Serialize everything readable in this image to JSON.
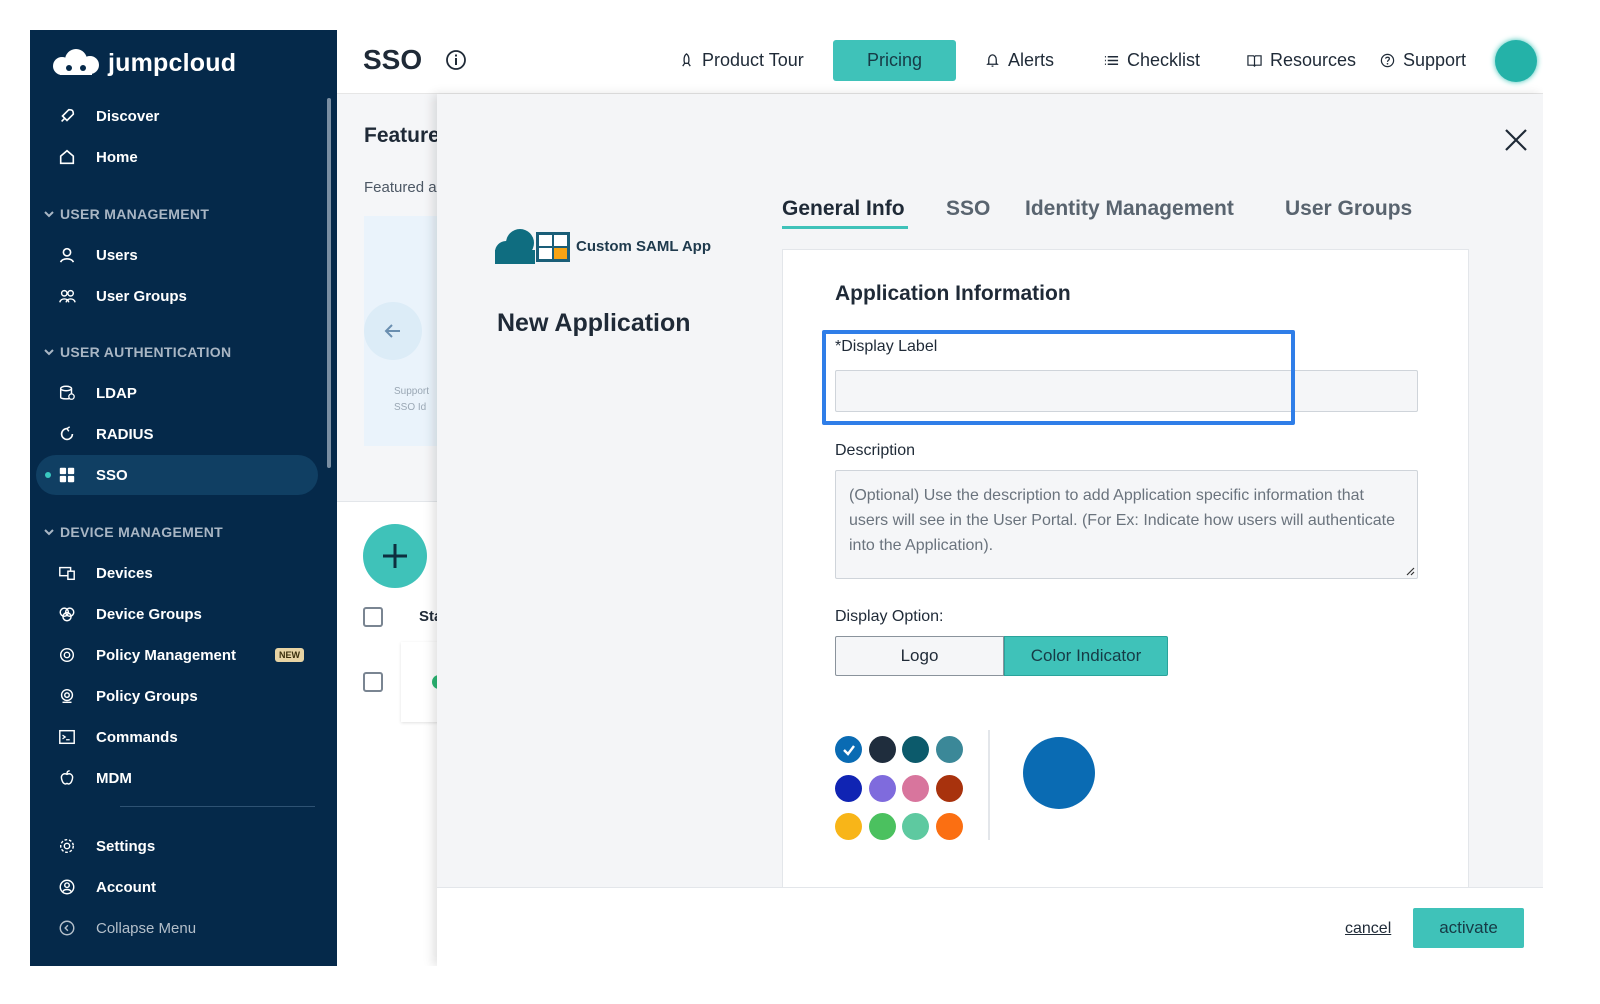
{
  "brand": {
    "name": "jumpcloud",
    "accent": "#3fc2b9",
    "sidebar_bg": "#05294a"
  },
  "sidebar": {
    "top_items": [
      {
        "label": "Discover",
        "icon": "rocket-icon"
      },
      {
        "label": "Home",
        "icon": "home-icon"
      }
    ],
    "sections": [
      {
        "title": "USER MANAGEMENT",
        "items": [
          {
            "label": "Users",
            "icon": "user-icon"
          },
          {
            "label": "User Groups",
            "icon": "user-group-icon"
          }
        ]
      },
      {
        "title": "USER AUTHENTICATION",
        "items": [
          {
            "label": "LDAP",
            "icon": "ldap-icon"
          },
          {
            "label": "RADIUS",
            "icon": "radius-icon"
          },
          {
            "label": "SSO",
            "icon": "sso-grid-icon",
            "active": true
          }
        ]
      },
      {
        "title": "DEVICE MANAGEMENT",
        "items": [
          {
            "label": "Devices",
            "icon": "devices-icon"
          },
          {
            "label": "Device Groups",
            "icon": "device-group-icon"
          },
          {
            "label": "Policy Management",
            "icon": "policy-icon",
            "badge": "NEW"
          },
          {
            "label": "Policy Groups",
            "icon": "policy-group-icon"
          },
          {
            "label": "Commands",
            "icon": "commands-icon"
          },
          {
            "label": "MDM",
            "icon": "apple-icon"
          }
        ]
      }
    ],
    "bottom_items": [
      {
        "label": "Settings",
        "icon": "gear-icon"
      },
      {
        "label": "Account",
        "icon": "account-icon"
      },
      {
        "label": "Collapse Menu",
        "icon": "collapse-icon"
      }
    ]
  },
  "topbar": {
    "title": "SSO",
    "links": {
      "product_tour": "Product Tour",
      "pricing": "Pricing",
      "alerts": "Alerts",
      "checklist": "Checklist",
      "resources": "Resources",
      "support": "Support"
    }
  },
  "background": {
    "featured_title": "Feature",
    "featured_sub": "Featured a",
    "card_line1": "Support",
    "card_line2": "SSO   Id",
    "column_label": "Sta"
  },
  "modal": {
    "app_type": "Custom SAML App",
    "heading": "New Application",
    "tabs": [
      "General Info",
      "SSO",
      "Identity Management",
      "User Groups"
    ],
    "active_tab": "General Info",
    "section_title": "Application Information",
    "display_label": {
      "label": "*Display Label",
      "value": ""
    },
    "description": {
      "label": "Description",
      "placeholder": "(Optional) Use the description to add Application specific information that users will see in the User Portal. (For Ex: Indicate how users will authenticate into the Application)."
    },
    "display_option": {
      "label": "Display Option:",
      "options": [
        "Logo",
        "Color Indicator"
      ],
      "selected": "Color Indicator"
    },
    "colors": [
      "#0a6bb3",
      "#1f2d3d",
      "#0c5a6b",
      "#3b8898",
      "#1024b3",
      "#7f6bdd",
      "#d8759d",
      "#a8320d",
      "#f8b518",
      "#4bc15f",
      "#5ec9a0",
      "#fb6f12"
    ],
    "selected_color": "#0a6bb3",
    "footer": {
      "cancel": "cancel",
      "activate": "activate"
    }
  }
}
